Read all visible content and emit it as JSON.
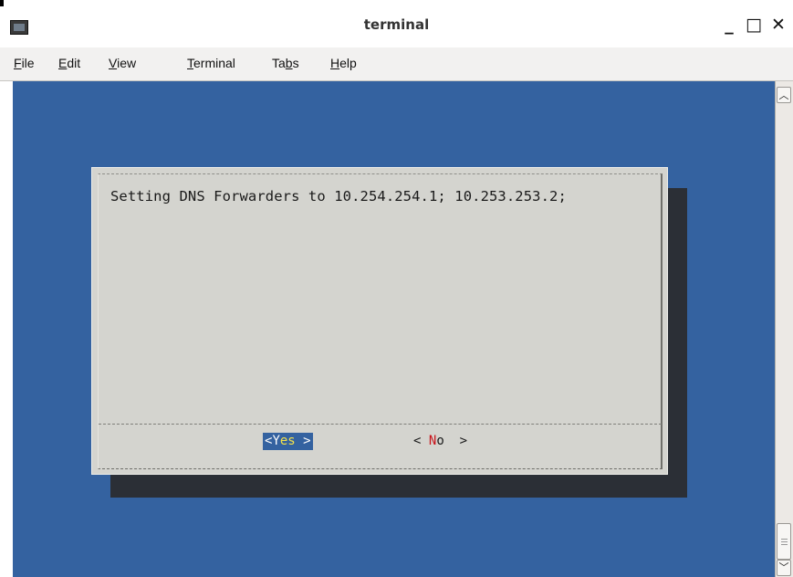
{
  "window": {
    "title": "terminal",
    "minimize_label": "_",
    "maximize_label": "□",
    "close_label": "✕"
  },
  "menu": [
    {
      "hot": "F",
      "rest": "ile"
    },
    {
      "hot": "E",
      "rest": "dit"
    },
    {
      "hot": "V",
      "rest": "iew"
    },
    {
      "hot": "T",
      "rest": "erminal"
    },
    {
      "pre": "Ta",
      "hot": "b",
      "rest": "s"
    },
    {
      "hot": "H",
      "rest": "elp"
    }
  ],
  "dialog": {
    "message": "Setting DNS Forwarders to 10.254.254.1; 10.253.253.2;",
    "yes_button": {
      "left": "<",
      "hot": "Y",
      "rest": "es",
      "right": ">"
    },
    "no_button": {
      "left": "<",
      "hot": "N",
      "rest": "o",
      "right": ">"
    }
  },
  "colors": {
    "terminal_background": "#3462a0",
    "dialog_background": "#d4d4cf",
    "shadow": "#2b2f36",
    "hotkey_red": "#c8141b",
    "selected_yellow": "#f5e24a"
  },
  "icons": {
    "app": "terminal-app-icon",
    "minimize": "minimize-icon",
    "maximize": "maximize-icon",
    "close": "close-icon",
    "scroll_up": "chevron-up-icon",
    "scroll_down": "chevron-down-icon"
  }
}
